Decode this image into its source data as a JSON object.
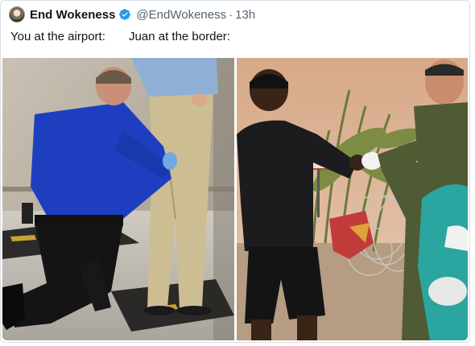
{
  "tweet": {
    "display_name": "End Wokeness",
    "handle": "@EndWokeness",
    "separator": "·",
    "time": "13h",
    "verified_icon": "verified-badge-icon",
    "text": "You at the airport:       Juan at the border:"
  },
  "colors": {
    "verified": "#1d9bf0",
    "secondary_text": "#536471",
    "primary_text": "#0f1419"
  },
  "media": [
    {
      "name": "airport-photo",
      "depicts": "airport-security-pat-down"
    },
    {
      "name": "border-photo",
      "depicts": "border-handshake-at-razor-wire"
    }
  ]
}
